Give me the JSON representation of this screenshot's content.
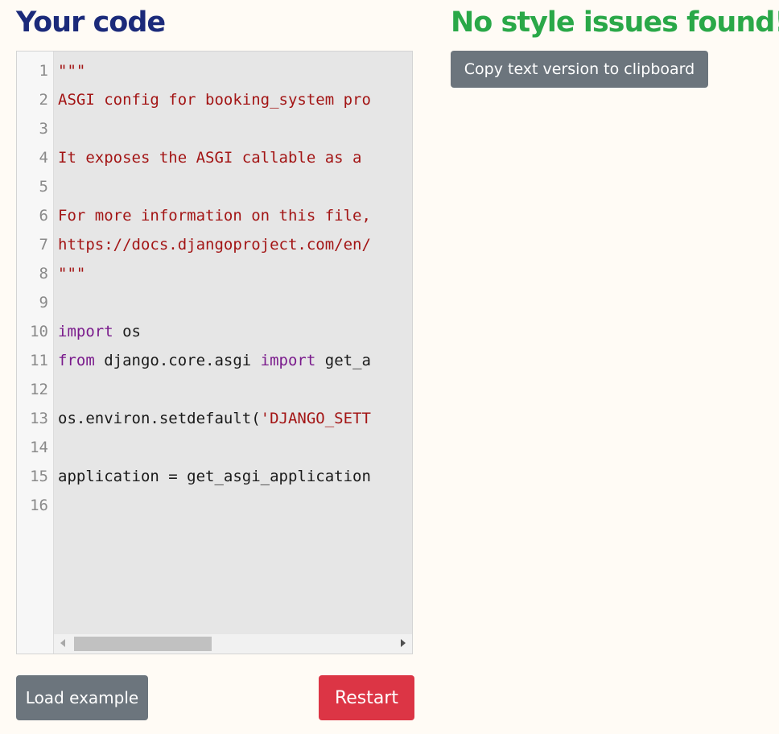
{
  "left_heading": "Your code",
  "right_heading": "No style issues found!",
  "copy_button": "Copy text version to clipboard",
  "load_button": "Load example",
  "restart_button": "Restart",
  "colors": {
    "left_heading": "#1b2a7a",
    "right_heading": "#2aa848",
    "secondary_button": "#6c757d",
    "danger_button": "#dc3545",
    "string": "#a31515",
    "keyword": "#7a1b8c"
  },
  "code_lines": [
    [
      {
        "t": "\"\"\"",
        "c": "str"
      }
    ],
    [
      {
        "t": "ASGI config for booking_system pro",
        "c": "str"
      }
    ],
    [],
    [
      {
        "t": "It exposes the ASGI callable as a ",
        "c": "str"
      }
    ],
    [],
    [
      {
        "t": "For more information on this file,",
        "c": "str"
      }
    ],
    [
      {
        "t": "https://docs.djangoproject.com/en/",
        "c": "str"
      }
    ],
    [
      {
        "t": "\"\"\"",
        "c": "str"
      }
    ],
    [],
    [
      {
        "t": "import",
        "c": "kw"
      },
      {
        "t": " os",
        "c": ""
      }
    ],
    [
      {
        "t": "from",
        "c": "kw"
      },
      {
        "t": " django.core.asgi ",
        "c": ""
      },
      {
        "t": "import",
        "c": "kw"
      },
      {
        "t": " get_a",
        "c": ""
      }
    ],
    [],
    [
      {
        "t": "os.environ.setdefault(",
        "c": ""
      },
      {
        "t": "'DJANGO_SETT",
        "c": "str"
      }
    ],
    [],
    [
      {
        "t": "application = get_asgi_application",
        "c": ""
      }
    ],
    []
  ]
}
